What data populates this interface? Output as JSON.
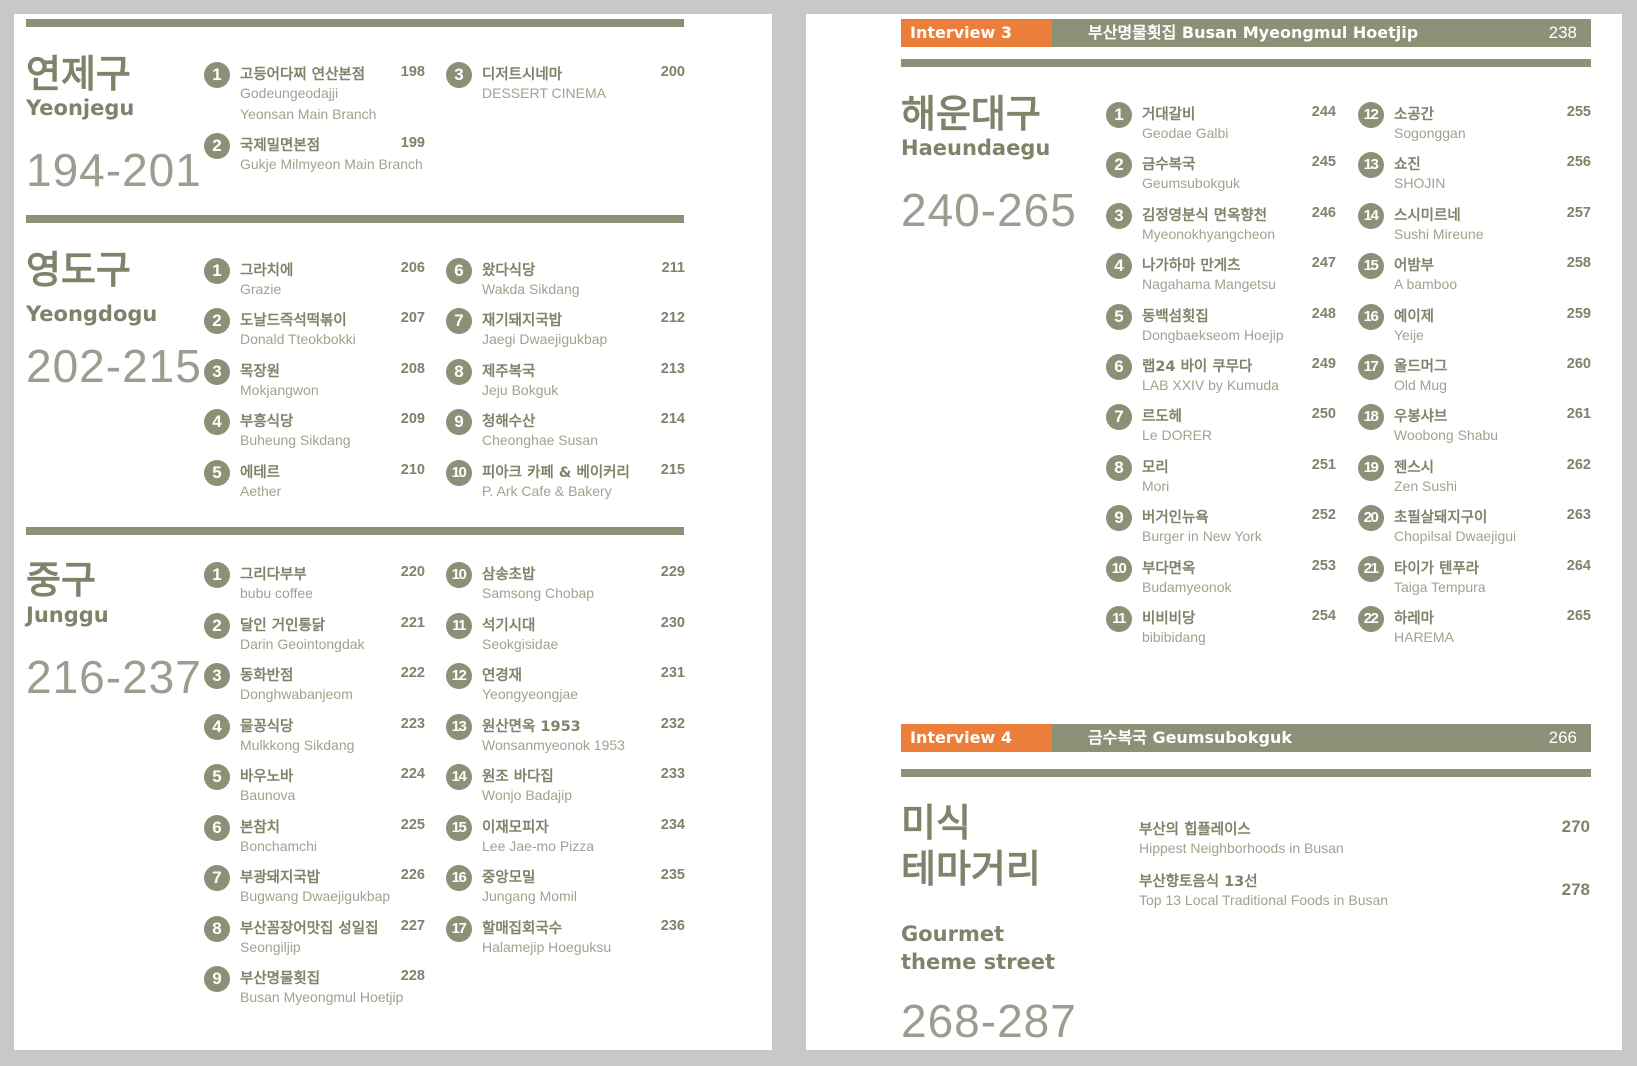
{
  "left_page": {
    "sections": [
      {
        "ko": "연제구",
        "en": "Yeonjegu",
        "range": "194-201",
        "columns": [
          [
            {
              "n": "1",
              "ko": "고등어다찌 연산본점",
              "en": "Godeungeodajji",
              "en2": "Yeonsan Main Branch",
              "page": "198"
            },
            {
              "n": "2",
              "ko": "국제밀면본점",
              "en": "Gukje Milmyeon Main Branch",
              "page": "199"
            }
          ],
          [
            {
              "n": "3",
              "ko": "디저트시네마",
              "en": "DESSERT CINEMA",
              "page": "200"
            }
          ]
        ]
      },
      {
        "ko": "영도구",
        "en": "Yeongdogu",
        "range": "202-215",
        "columns": [
          [
            {
              "n": "1",
              "ko": "그라치에",
              "en": "Grazie",
              "page": "206"
            },
            {
              "n": "2",
              "ko": "도날드즉석떡볶이",
              "en": "Donald Tteokbokki",
              "page": "207"
            },
            {
              "n": "3",
              "ko": "목장원",
              "en": "Mokjangwon",
              "page": "208"
            },
            {
              "n": "4",
              "ko": "부흥식당",
              "en": "Buheung Sikdang",
              "page": "209"
            },
            {
              "n": "5",
              "ko": "에테르",
              "en": "Aether",
              "page": "210"
            }
          ],
          [
            {
              "n": "6",
              "ko": "왔다식당",
              "en": "Wakda Sikdang",
              "page": "211"
            },
            {
              "n": "7",
              "ko": "재기돼지국밥",
              "en": "Jaegi Dwaejigukbap",
              "page": "212"
            },
            {
              "n": "8",
              "ko": "제주복국",
              "en": "Jeju Bokguk",
              "page": "213"
            },
            {
              "n": "9",
              "ko": "청해수산",
              "en": "Cheonghae Susan",
              "page": "214"
            },
            {
              "n": "10",
              "ko": "피아크 카페 & 베이커리",
              "en": "P. Ark Cafe & Bakery",
              "page": "215"
            }
          ]
        ]
      },
      {
        "ko": "중구",
        "en": "Junggu",
        "range": "216-237",
        "columns": [
          [
            {
              "n": "1",
              "ko": "그리다부부",
              "en": "bubu coffee",
              "page": "220"
            },
            {
              "n": "2",
              "ko": "달인 거인통닭",
              "en": "Darin Geointongdak",
              "page": "221"
            },
            {
              "n": "3",
              "ko": "동화반점",
              "en": "Donghwabanjeom",
              "page": "222"
            },
            {
              "n": "4",
              "ko": "물꽁식당",
              "en": "Mulkkong Sikdang",
              "page": "223"
            },
            {
              "n": "5",
              "ko": "바우노바",
              "en": "Baunova",
              "page": "224"
            },
            {
              "n": "6",
              "ko": "본참치",
              "en": "Bonchamchi",
              "page": "225"
            },
            {
              "n": "7",
              "ko": "부광돼지국밥",
              "en": "Bugwang Dwaejigukbap",
              "page": "226"
            },
            {
              "n": "8",
              "ko": "부산꼼장어맛집 성일집",
              "en": "Seongiljip",
              "page": "227"
            },
            {
              "n": "9",
              "ko": "부산명물횟집",
              "en": "Busan Myeongmul Hoetjip",
              "page": "228"
            }
          ],
          [
            {
              "n": "10",
              "ko": "삼송초밥",
              "en": "Samsong Chobap",
              "page": "229"
            },
            {
              "n": "11",
              "ko": "석기시대",
              "en": "Seokgisidae",
              "page": "230"
            },
            {
              "n": "12",
              "ko": "연경재",
              "en": "Yeongyeongjae",
              "page": "231"
            },
            {
              "n": "13",
              "ko": "원산면옥 1953",
              "en": "Wonsanmyeonok 1953",
              "page": "232"
            },
            {
              "n": "14",
              "ko": "원조 바다집",
              "en": "Wonjo Badajip",
              "page": "233"
            },
            {
              "n": "15",
              "ko": "이재모피자",
              "en": "Lee Jae-mo Pizza",
              "page": "234"
            },
            {
              "n": "16",
              "ko": "중앙모밀",
              "en": "Jungang Momil",
              "page": "235"
            },
            {
              "n": "17",
              "ko": "할매집회국수",
              "en": "Halamejip Hoeguksu",
              "page": "236"
            }
          ]
        ]
      }
    ]
  },
  "right_page": {
    "interview3": {
      "label": "Interview  3",
      "title": "부산명물횟집  Busan Myeongmul Hoetjip",
      "page": "238"
    },
    "haeundae": {
      "ko": "해운대구",
      "en": "Haeundaegu",
      "range": "240-265",
      "columns": [
        [
          {
            "n": "1",
            "ko": "거대갈비",
            "en": "Geodae Galbi",
            "page": "244"
          },
          {
            "n": "2",
            "ko": "금수복국",
            "en": "Geumsubokguk",
            "page": "245"
          },
          {
            "n": "3",
            "ko": "김정영분식 면옥향천",
            "en": "Myeonokhyangcheon",
            "page": "246"
          },
          {
            "n": "4",
            "ko": "나가하마 만게츠",
            "en": "Nagahama Mangetsu",
            "page": "247"
          },
          {
            "n": "5",
            "ko": "동백섬횟집",
            "en": "Dongbaekseom Hoejip",
            "page": "248"
          },
          {
            "n": "6",
            "ko": "랩24 바이 쿠무다",
            "en": "LAB XXIV by Kumuda",
            "page": "249"
          },
          {
            "n": "7",
            "ko": "르도헤",
            "en": "Le DORER",
            "page": "250"
          },
          {
            "n": "8",
            "ko": "모리",
            "en": "Mori",
            "page": "251"
          },
          {
            "n": "9",
            "ko": "버거인뉴욕",
            "en": "Burger in New York",
            "page": "252"
          },
          {
            "n": "10",
            "ko": "부다면옥",
            "en": "Budamyeonok",
            "page": "253"
          },
          {
            "n": "11",
            "ko": "비비비당",
            "en": "bibibidang",
            "page": "254"
          }
        ],
        [
          {
            "n": "12",
            "ko": "소공간",
            "en": "Sogonggan",
            "page": "255"
          },
          {
            "n": "13",
            "ko": "쇼진",
            "en": "SHOJIN",
            "page": "256"
          },
          {
            "n": "14",
            "ko": "스시미르네",
            "en": "Sushi Mireune",
            "page": "257"
          },
          {
            "n": "15",
            "ko": "어밤부",
            "en": "A bamboo",
            "page": "258"
          },
          {
            "n": "16",
            "ko": "예이제",
            "en": "Yeije",
            "page": "259"
          },
          {
            "n": "17",
            "ko": "올드머그",
            "en": "Old Mug",
            "page": "260"
          },
          {
            "n": "18",
            "ko": "우봉샤브",
            "en": "Woobong Shabu",
            "page": "261"
          },
          {
            "n": "19",
            "ko": "젠스시",
            "en": "Zen Sushi",
            "page": "262"
          },
          {
            "n": "20",
            "ko": "초필살돼지구이",
            "en": "Chopilsal Dwaejigui",
            "page": "263"
          },
          {
            "n": "21",
            "ko": "타이가 텐푸라",
            "en": "Taiga Tempura",
            "page": "264"
          },
          {
            "n": "22",
            "ko": "하레마",
            "en": "HAREMA",
            "page": "265"
          }
        ]
      ]
    },
    "interview4": {
      "label": "Interview  4",
      "title": "금수복국  Geumsubokguk",
      "page": "266"
    },
    "theme": {
      "ko_line1": "미식",
      "ko_line2": "테마거리",
      "en_line1": "Gourmet",
      "en_line2": "theme street",
      "range": "268-287",
      "entries": [
        {
          "ko": "부산의 힙플레이스",
          "en": "Hippest Neighborhoods in Busan",
          "page": "270"
        },
        {
          "ko": "부산향토음식 13선",
          "en": "Top 13 Local Traditional Foods in Busan",
          "page": "278"
        }
      ]
    }
  }
}
